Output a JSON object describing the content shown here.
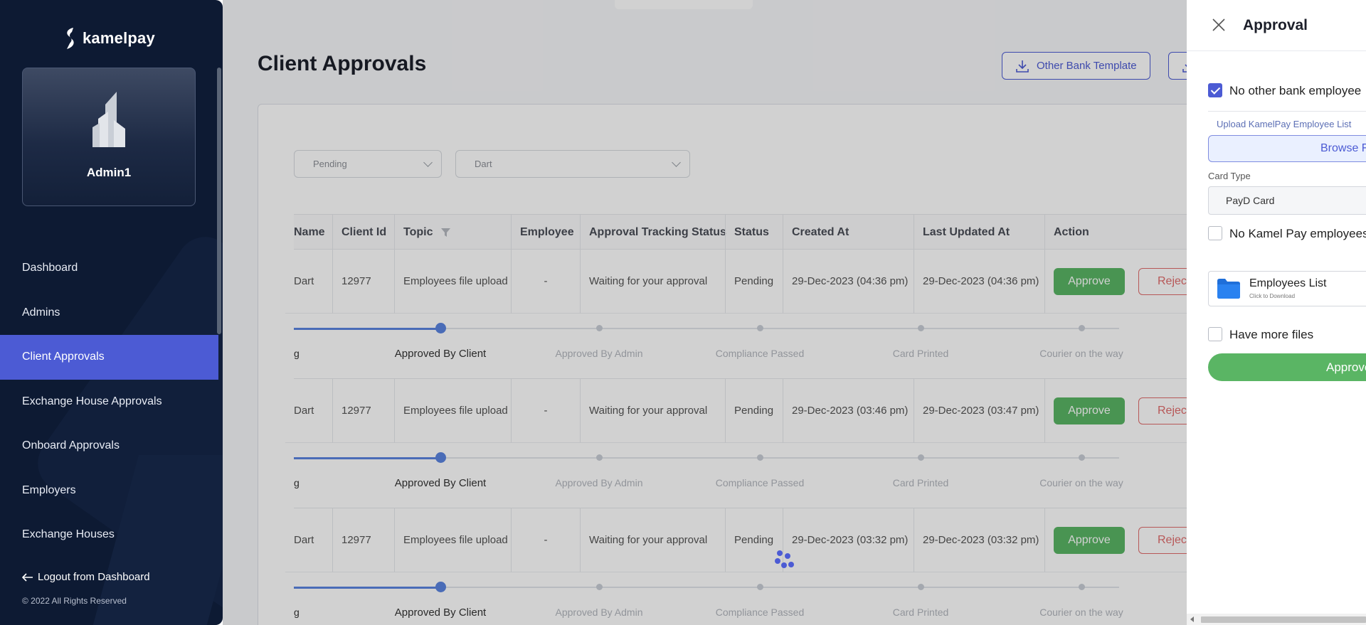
{
  "sidebar": {
    "logo_text": "kamelpay",
    "admin_name": "Admin1",
    "items": [
      {
        "label": "Dashboard",
        "active": false
      },
      {
        "label": "Admins",
        "active": false
      },
      {
        "label": "Client Approvals",
        "active": true
      },
      {
        "label": "Exchange House Approvals",
        "active": false
      },
      {
        "label": "Onboard Approvals",
        "active": false
      },
      {
        "label": "Employers",
        "active": false
      },
      {
        "label": "Exchange Houses",
        "active": false
      }
    ],
    "logout": "Logout from Dashboard",
    "copyright": "© 2022 All Rights Reserved"
  },
  "main": {
    "title": "Client Approvals",
    "other_bank_template": "Other Bank Template",
    "filters": {
      "status": "Pending",
      "client": "Dart"
    },
    "columns": [
      "Name",
      "Client Id",
      "Topic",
      "Employee",
      "Approval Tracking Status",
      "Status",
      "Created At",
      "Last Updated At",
      "Action"
    ],
    "rows": [
      {
        "name": "Dart",
        "client_id": "12977",
        "topic": "Employees file upload",
        "employee": "-",
        "tracking": "Waiting for your approval",
        "status": "Pending",
        "created": "29-Dec-2023 (04:36 pm)",
        "updated": "29-Dec-2023 (04:36 pm)",
        "approve": "Approve",
        "reject": "Reject"
      },
      {
        "name": "Dart",
        "client_id": "12977",
        "topic": "Employees file upload",
        "employee": "-",
        "tracking": "Waiting for your approval",
        "status": "Pending",
        "created": "29-Dec-2023 (03:46 pm)",
        "updated": "29-Dec-2023 (03:47 pm)",
        "approve": "Approve",
        "reject": "Reject"
      },
      {
        "name": "Dart",
        "client_id": "12977",
        "topic": "Employees file upload",
        "employee": "-",
        "tracking": "Waiting for your approval",
        "status": "Pending",
        "created": "29-Dec-2023 (03:32 pm)",
        "updated": "29-Dec-2023 (03:32 pm)",
        "approve": "Approve",
        "reject": "Reject"
      }
    ],
    "steps": [
      "g",
      "Approved By Client",
      "Approved By Admin",
      "Compliance Passed",
      "Card Printed",
      "Courier on the way"
    ]
  },
  "drawer": {
    "title": "Approval",
    "no_other_bank": "No other bank employee",
    "no_other_bank_checked": true,
    "upload_label": "Upload KamelPay Employee List",
    "browse": "Browse Fi",
    "card_type_label": "Card Type",
    "card_type_value": "PayD Card",
    "no_kamelpay": "No Kamel Pay employees",
    "no_kamelpay_checked": false,
    "file_title": "Employees List",
    "file_sub": "Click to Download",
    "have_more_files": "Have more files",
    "have_more_files_checked": false,
    "approve": "Approve"
  },
  "colors": {
    "accent": "#4c5bd4",
    "sidebar_bg": "#0d1a33",
    "approve_green": "#5ab564",
    "reject_red": "#e06b6b"
  }
}
